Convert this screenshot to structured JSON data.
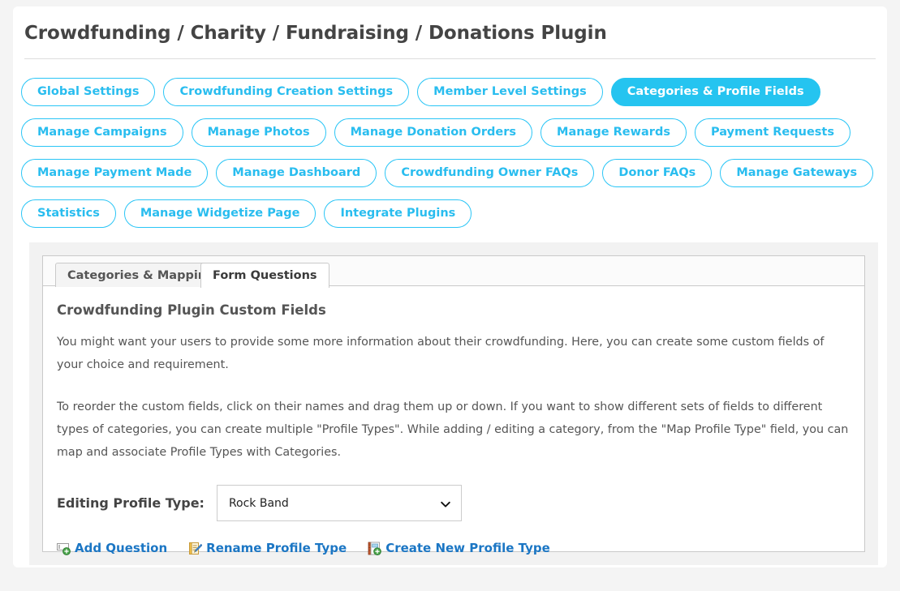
{
  "page": {
    "title": "Crowdfunding / Charity / Fundraising / Donations Plugin"
  },
  "nav": {
    "rows": [
      [
        {
          "label": "Global Settings",
          "active": false
        },
        {
          "label": "Crowdfunding Creation Settings",
          "active": false
        },
        {
          "label": "Member Level Settings",
          "active": false
        },
        {
          "label": "Categories & Profile Fields",
          "active": true
        }
      ],
      [
        {
          "label": "Manage Campaigns",
          "active": false
        },
        {
          "label": "Manage Photos",
          "active": false
        },
        {
          "label": "Manage Donation Orders",
          "active": false
        },
        {
          "label": "Manage Rewards",
          "active": false
        },
        {
          "label": "Payment Requests",
          "active": false
        }
      ],
      [
        {
          "label": "Manage Payment Made",
          "active": false
        },
        {
          "label": "Manage Dashboard",
          "active": false
        },
        {
          "label": "Crowdfunding Owner FAQs",
          "active": false
        },
        {
          "label": "Donor FAQs",
          "active": false
        },
        {
          "label": "Manage Gateways",
          "active": false
        }
      ],
      [
        {
          "label": "Statistics",
          "active": false
        },
        {
          "label": "Manage Widgetize Page",
          "active": false
        },
        {
          "label": "Integrate Plugins",
          "active": false
        }
      ]
    ]
  },
  "tabs": {
    "inactive_label": "Categories & Mapping",
    "active_label": "Form Questions"
  },
  "content": {
    "heading": "Crowdfunding Plugin Custom Fields",
    "paragraph_1": "You might want your users to provide some more information about their crowdfunding. Here, you can create some custom fields of your choice and requirement.",
    "paragraph_2": "To reorder the custom fields, click on their names and drag them up or down. If you want to show different sets of fields to different types of categories, you can create multiple \"Profile Types\". While adding / editing a category, from the \"Map Profile Type\" field, you can map and associate Profile Types with Categories.",
    "profile_type_label": "Editing Profile Type:",
    "profile_type_value": "Rock Band",
    "profile_type_options": [
      "Rock Band"
    ]
  },
  "actions": [
    {
      "label": "Add Question",
      "icon": "add-question-icon"
    },
    {
      "label": "Rename Profile Type",
      "icon": "rename-pencil-icon"
    },
    {
      "label": "Create New Profile Type",
      "icon": "create-new-icon"
    }
  ],
  "colors": {
    "accent": "#25c4f0",
    "link": "#1b76c4",
    "page_bg": "#f4f4f4",
    "text": "#555555"
  }
}
